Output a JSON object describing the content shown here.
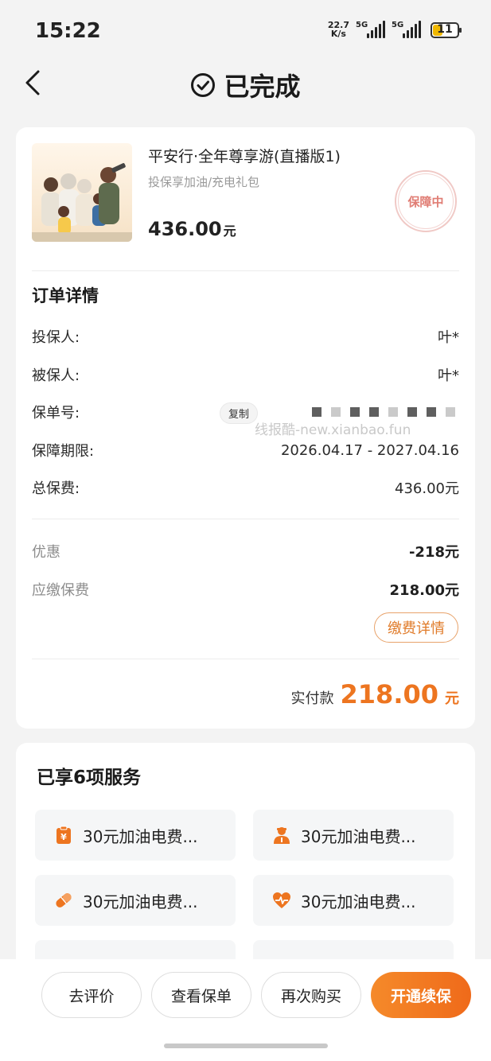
{
  "status_bar": {
    "time": "15:22",
    "speed_value": "22.7",
    "speed_unit": "K/s",
    "network1": "5G",
    "network2": "5G",
    "battery": "11"
  },
  "header": {
    "title": "已完成"
  },
  "product": {
    "name": "平安行·全年尊享游(直播版1)",
    "subtitle": "投保享加油/充电礼包",
    "price": "436.00",
    "price_unit": "元",
    "status_stamp": "保障中"
  },
  "order_details": {
    "title": "订单详情",
    "rows": [
      {
        "label": "投保人:",
        "value": "叶*"
      },
      {
        "label": "被保人:",
        "value": "叶*"
      },
      {
        "label": "保单号:",
        "value": ""
      },
      {
        "label": "保障期限:",
        "value": "2026.04.17 - 2027.04.16"
      },
      {
        "label": "总保费:",
        "value": "436.00元"
      }
    ],
    "copy_label": "复制",
    "watermark": "线报酷-new.xianbao.fun"
  },
  "payment": {
    "discount_label": "优惠",
    "discount_value": "-218元",
    "payable_label": "应缴保费",
    "payable_value": "218.00元",
    "detail_button": "缴费详情",
    "paid_label": "实付款",
    "paid_amount": "218.00",
    "paid_unit": "元"
  },
  "services": {
    "title": "已享6项服务",
    "items": [
      {
        "label": "30元加油电费...",
        "icon": "clipboard-yen-icon"
      },
      {
        "label": "30元加油电费...",
        "icon": "person-icon"
      },
      {
        "label": "30元加油电费...",
        "icon": "pill-icon"
      },
      {
        "label": "30元加油电费...",
        "icon": "heart-pulse-icon"
      }
    ]
  },
  "actions": {
    "review": "去评价",
    "view_policy": "查看保单",
    "buy_again": "再次购买",
    "renew": "开通续保"
  },
  "colors": {
    "accent": "#ED7520",
    "stamp": "#E07D74",
    "background": "#F3F3F3"
  }
}
